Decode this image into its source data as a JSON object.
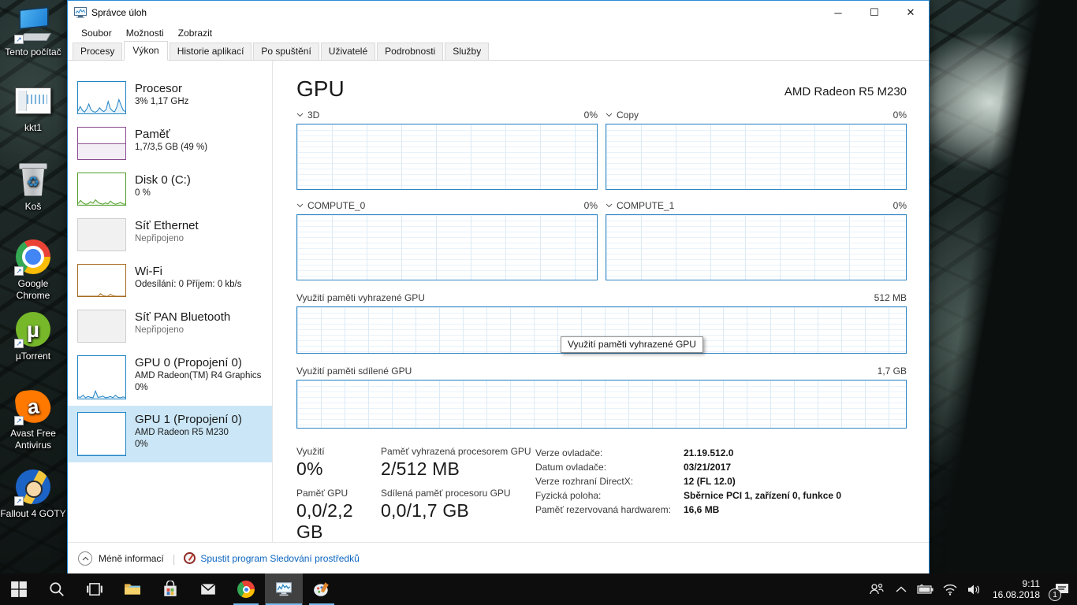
{
  "desktop": {
    "icons": [
      {
        "label": "Tento počítač",
        "shortcut": true
      },
      {
        "label": "kkt1",
        "shortcut": false
      },
      {
        "label": "Koš",
        "shortcut": false
      },
      {
        "label": "Google Chrome",
        "shortcut": true
      },
      {
        "label": "µTorrent",
        "shortcut": true
      },
      {
        "label": "Avast Free Antivirus",
        "shortcut": true
      },
      {
        "label": "Fallout 4 GOTY",
        "shortcut": true
      }
    ]
  },
  "window": {
    "title": "Správce úloh",
    "controls": {
      "minimize": "─",
      "maximize": "☐",
      "close": "✕"
    },
    "menu": [
      "Soubor",
      "Možnosti",
      "Zobrazit"
    ],
    "tabs": [
      "Procesy",
      "Výkon",
      "Historie aplikací",
      "Po spuštění",
      "Uživatelé",
      "Podrobnosti",
      "Služby"
    ],
    "active_tab": "Výkon",
    "sidebar": {
      "items": [
        {
          "title": "Procesor",
          "sub": "3%  1,17 GHz",
          "color": "#1f83c4",
          "spark": [
            8,
            22,
            10,
            4,
            14,
            30,
            12,
            6,
            4,
            8,
            18,
            10,
            6,
            12,
            38,
            16,
            8,
            5,
            20,
            44,
            26,
            10,
            6
          ]
        },
        {
          "title": "Paměť",
          "sub": "1,7/3,5 GB (49 %)",
          "color": "#8b4b8f",
          "spark": [
            49,
            49,
            49,
            49,
            49,
            49,
            49,
            49,
            49,
            49,
            49,
            49
          ]
        },
        {
          "title": "Disk 0 (C:)",
          "sub": "0 %",
          "color": "#4f9e2a",
          "spark": [
            4,
            14,
            6,
            2,
            3,
            10,
            5,
            16,
            8,
            4,
            2,
            6,
            3,
            12,
            5,
            2,
            4,
            8,
            3,
            2
          ]
        },
        {
          "title": "Síť Ethernet",
          "sub": "Nepřipojeno",
          "color": "#cfcfcf",
          "spark": null
        },
        {
          "title": "Wi-Fi",
          "sub": "Odesílání: 0 Příjem: 0 kb/s",
          "color": "#a6691e",
          "spark": [
            0,
            0,
            0,
            0,
            0,
            0,
            0,
            0,
            0,
            8,
            2,
            0,
            0,
            6,
            2,
            0,
            0,
            0,
            0,
            0
          ]
        },
        {
          "title": "Síť PAN Bluetooth",
          "sub": "Nepřipojeno",
          "color": "#cfcfcf",
          "spark": null
        },
        {
          "title": "GPU 0 (Propojení 0)",
          "sub": "AMD Radeon(TM) R4 Graphics",
          "sub2": "0%",
          "color": "#1f83c4",
          "spark": [
            4,
            3,
            8,
            2,
            5,
            3,
            2,
            18,
            3,
            4,
            6,
            2,
            3,
            5,
            2,
            8,
            3,
            2,
            4,
            3
          ]
        },
        {
          "title": "GPU 1 (Propojení 0)",
          "sub": "AMD Radeon R5 M230",
          "sub2": "0%",
          "color": "#1f83c4",
          "selected": true,
          "spark": [
            0,
            0,
            0,
            0,
            0,
            0,
            0,
            0,
            0,
            0,
            0,
            0
          ]
        }
      ]
    },
    "main": {
      "title": "GPU",
      "device_name": "AMD Radeon R5 M230",
      "engine_charts": [
        {
          "label": "3D",
          "value": "0%"
        },
        {
          "label": "Copy",
          "value": "0%"
        },
        {
          "label": "COMPUTE_0",
          "value": "0%"
        },
        {
          "label": "COMPUTE_1",
          "value": "0%"
        }
      ],
      "memory_charts": [
        {
          "label": "Využití paměti vyhrazené GPU",
          "max": "512 MB"
        },
        {
          "label": "Využití paměti sdílené GPU",
          "max": "1,7 GB"
        }
      ],
      "tooltip": "Využití paměti vyhrazené GPU",
      "stats": [
        {
          "label": "Využití",
          "value": "0%"
        },
        {
          "label": "Paměť vyhrazená procesorem GPU",
          "value": "2/512 MB"
        },
        {
          "label": "Paměť GPU",
          "value": "0,0/2,2 GB"
        },
        {
          "label": "Sdílená paměť procesoru GPU",
          "value": "0,0/1,7 GB"
        }
      ],
      "info": [
        {
          "label": "Verze ovladače:",
          "value": "21.19.512.0"
        },
        {
          "label": "Datum ovladače:",
          "value": "03/21/2017"
        },
        {
          "label": "Verze rozhraní DirectX:",
          "value": "12 (FL 12.0)"
        },
        {
          "label": "Fyzická poloha:",
          "value": "Sběrnice PCI 1, zařízení 0, funkce 0"
        },
        {
          "label": "Paměť rezervovaná hardwarem:",
          "value": "16,6 MB"
        }
      ]
    },
    "footer": {
      "less_info": "Méně informací",
      "resmon": "Spustit program Sledování prostředků"
    }
  },
  "taskbar": {
    "tray": {
      "time": "9:11",
      "date": "16.08.2018",
      "badge": "1"
    }
  },
  "colors": {
    "accent_blue": "#1f83c4",
    "chart_border": "#2f86c3",
    "selection_bg": "#cbe7f7",
    "memory_purple": "#8b4b8f",
    "disk_green": "#4f9e2a",
    "wifi_brown": "#a6691e",
    "link_blue": "#0a64c0",
    "taskbar_bg": "#0d0d0d"
  }
}
